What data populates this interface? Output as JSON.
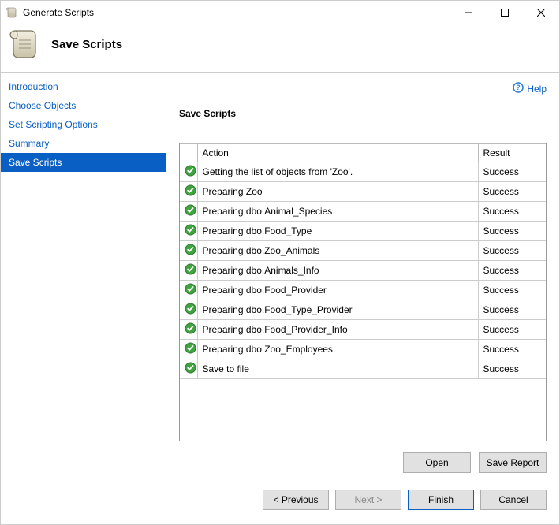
{
  "window": {
    "title": "Generate Scripts"
  },
  "header": {
    "title": "Save Scripts"
  },
  "help": {
    "label": "Help"
  },
  "sidebar": {
    "items": [
      {
        "label": "Introduction",
        "active": false
      },
      {
        "label": "Choose Objects",
        "active": false
      },
      {
        "label": "Set Scripting Options",
        "active": false
      },
      {
        "label": "Summary",
        "active": false
      },
      {
        "label": "Save Scripts",
        "active": true
      }
    ]
  },
  "content": {
    "section_label": "Save Scripts",
    "columns": {
      "icon": "",
      "action": "Action",
      "result": "Result"
    },
    "rows": [
      {
        "action": "Getting the list of objects from 'Zoo'.",
        "result": "Success"
      },
      {
        "action": "Preparing Zoo",
        "result": "Success"
      },
      {
        "action": "Preparing dbo.Animal_Species",
        "result": "Success"
      },
      {
        "action": "Preparing dbo.Food_Type",
        "result": "Success"
      },
      {
        "action": "Preparing dbo.Zoo_Animals",
        "result": "Success"
      },
      {
        "action": "Preparing dbo.Animals_Info",
        "result": "Success"
      },
      {
        "action": "Preparing dbo.Food_Provider",
        "result": "Success"
      },
      {
        "action": "Preparing dbo.Food_Type_Provider",
        "result": "Success"
      },
      {
        "action": "Preparing dbo.Food_Provider_Info",
        "result": "Success"
      },
      {
        "action": "Preparing dbo.Zoo_Employees",
        "result": "Success"
      },
      {
        "action": "Save to file",
        "result": "Success"
      }
    ],
    "buttons": {
      "open": "Open",
      "save_report": "Save Report"
    }
  },
  "footer": {
    "previous": "< Previous",
    "next": "Next >",
    "finish": "Finish",
    "cancel": "Cancel"
  }
}
